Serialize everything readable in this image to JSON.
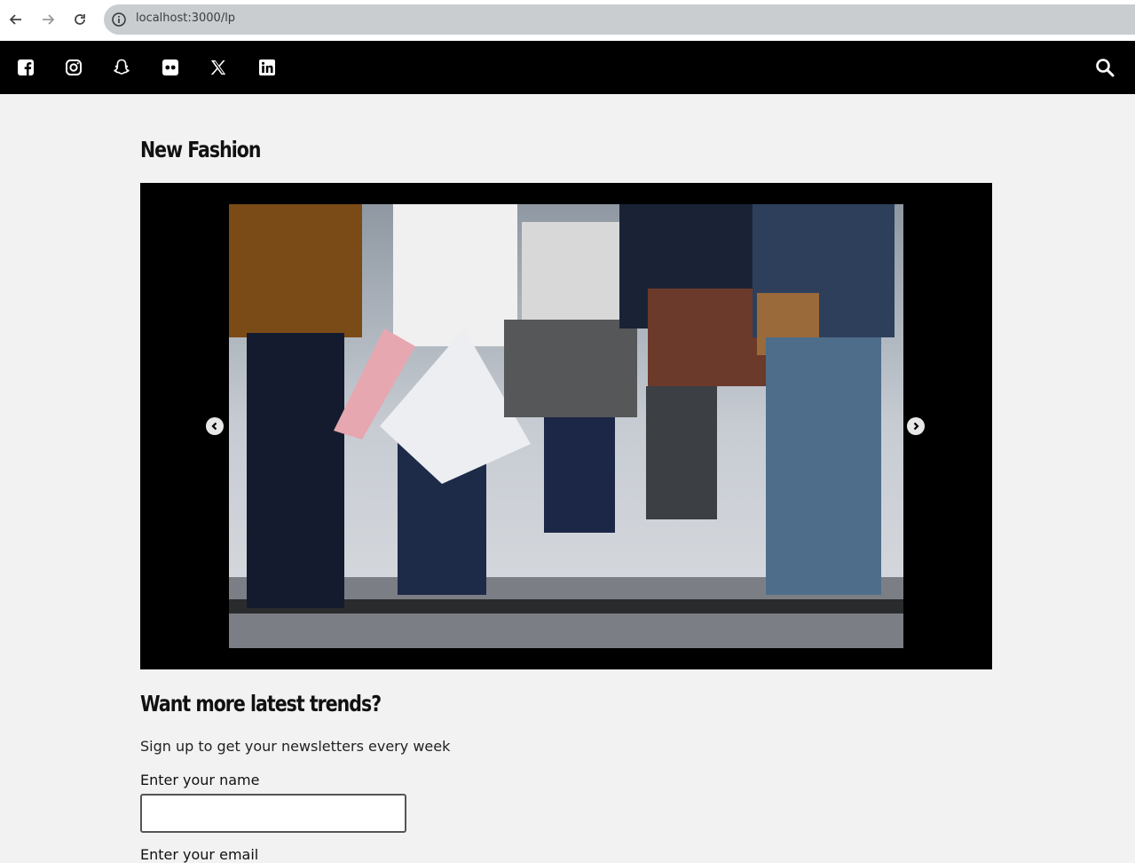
{
  "browser": {
    "url": "localhost:3000/lp",
    "icons": {
      "back": "arrow-left-icon",
      "forward": "arrow-right-icon",
      "reload": "reload-icon",
      "site_info": "info-icon"
    }
  },
  "topbar": {
    "social": [
      "facebook-icon",
      "instagram-icon",
      "snapchat-icon",
      "flickr-icon",
      "x-twitter-icon",
      "linkedin-icon"
    ],
    "search_icon": "search-icon",
    "bg_color": "#000000"
  },
  "main": {
    "title": "New Fashion",
    "carousel": {
      "prev_icon": "chevron-left-circle-icon",
      "next_icon": "chevron-right-circle-icon"
    },
    "newsletter": {
      "title": "Want more latest trends?",
      "subtitle": "Sign up to get your newsletters every week",
      "name_label": "Enter your name",
      "name_value": "",
      "email_label": "Enter your email"
    }
  }
}
